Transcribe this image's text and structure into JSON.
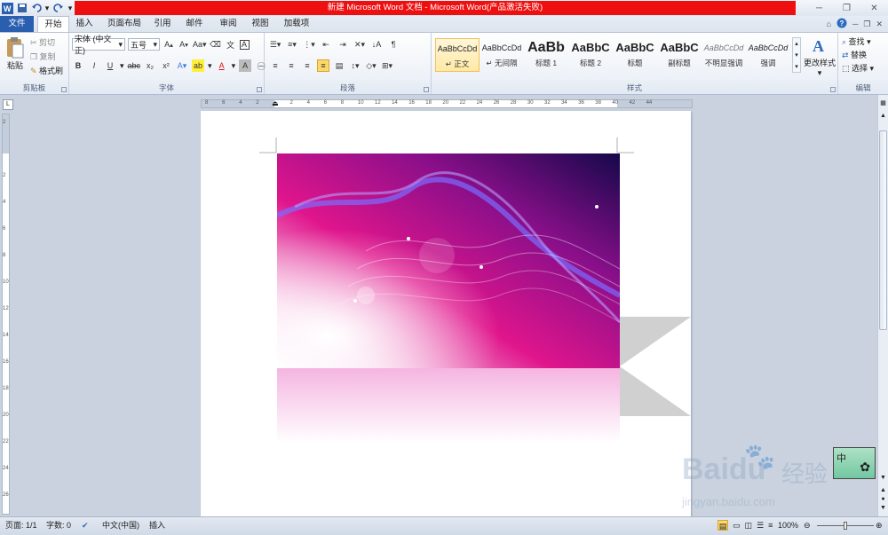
{
  "title_bar": {
    "title": "新建 Microsoft Word 文档 - Microsoft Word(产品激活失败)"
  },
  "tabs": [
    "文件",
    "开始",
    "插入",
    "页面布局",
    "引用",
    "邮件",
    "审阅",
    "视图",
    "加载项"
  ],
  "clipboard": {
    "paste": "粘贴",
    "cut": "剪切",
    "copy": "复制",
    "format_painter": "格式刷",
    "label": "剪贴板"
  },
  "font": {
    "name": "宋体 (中文正)",
    "size": "五号",
    "label": "字体",
    "aa": "Aa",
    "char_border": "A"
  },
  "paragraph": {
    "label": "段落"
  },
  "styles": {
    "label": "样式",
    "items": [
      {
        "sample": "AaBbCcDd",
        "name": "正文"
      },
      {
        "sample": "AaBbCcDd",
        "name": "无间隔"
      },
      {
        "sample": "AaBb",
        "name": "标题 1"
      },
      {
        "sample": "AaBbC",
        "name": "标题 2"
      },
      {
        "sample": "AaBbC",
        "name": "标题"
      },
      {
        "sample": "AaBbC",
        "name": "副标题"
      },
      {
        "sample": "AaBbCcDd",
        "name": "不明显强调"
      },
      {
        "sample": "AaBbCcDd",
        "name": "强调"
      }
    ],
    "change": "更改样式"
  },
  "editing": {
    "find": "查找",
    "replace": "替换",
    "select": "选择",
    "label": "编辑"
  },
  "ruler_top": [
    "8",
    "6",
    "4",
    "2",
    "",
    "2",
    "4",
    "6",
    "8",
    "10",
    "12",
    "14",
    "16",
    "18",
    "20",
    "22",
    "24",
    "26",
    "28",
    "30",
    "32",
    "34",
    "36",
    "38",
    "40",
    "42",
    "44"
  ],
  "ruler_left": [
    "2",
    "",
    "2",
    "4",
    "6",
    "8",
    "10",
    "12",
    "14",
    "16",
    "18",
    "20",
    "22",
    "24",
    "26"
  ],
  "status": {
    "page": "页面: 1/1",
    "words": "字数: 0",
    "lang": "中文(中国)",
    "mode": "插入",
    "zoom": "100%"
  },
  "ime": {
    "text": "中"
  },
  "watermark": {
    "brand": "Baidu",
    "brand_cn": "经验",
    "url": "jingyan.baidu.com"
  },
  "colors": {
    "title_red": "#ee1010",
    "file_tab": "#2a5fb0",
    "ribbon_bg": "#eef2f8",
    "workspace": "#c9d2de"
  }
}
